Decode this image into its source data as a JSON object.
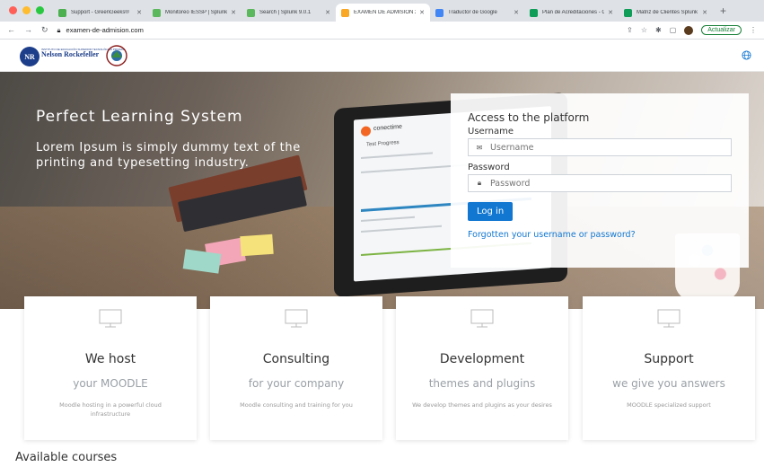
{
  "browser": {
    "tabs": [
      {
        "title": "Support - GreenGeeks®",
        "color": "#4caf50"
      },
      {
        "title": "Monitoreo IESSP | Splunk",
        "color": "#5cb85c"
      },
      {
        "title": "Search | Splunk 9.0.1",
        "color": "#5cb85c"
      },
      {
        "title": "EXAMEN DE ADMISION 20",
        "color": "#f9a825",
        "active": true
      },
      {
        "title": "Traductor de Google",
        "color": "#4285f4"
      },
      {
        "title": "Plan de Acreditaciones - G",
        "color": "#0f9d58"
      },
      {
        "title": "Matriz de Clientes Splunk",
        "color": "#0f9d58"
      }
    ],
    "new_tab": "+",
    "url": "examen-de-admision.com",
    "update_label": "Actualizar"
  },
  "site": {
    "logo_initials": "NR",
    "logo_small": "INSTITUTO DE EDUCACIÓN SUPERIOR TECNOLÓGICO PRIVADO",
    "logo_name": "Nelson Rockefeller"
  },
  "hero": {
    "title": "Perfect Learning System",
    "subtitle": "Lorem Ipsum is simply dummy text of the printing and typesetting industry.",
    "laptop_app": "conectime",
    "laptop_heading": "Test Progress"
  },
  "login": {
    "heading": "Access to the platform",
    "username_label": "Username",
    "username_placeholder": "Username",
    "password_label": "Password",
    "password_placeholder": "Password",
    "submit": "Log in",
    "forgot": "Forgotten your username or password?"
  },
  "cards": [
    {
      "title": "We host",
      "subtitle": "your MOODLE",
      "desc": "Moodle hosting in a powerful cloud infrastructure"
    },
    {
      "title": "Consulting",
      "subtitle": "for your company",
      "desc": "Moodle consulting and training for you"
    },
    {
      "title": "Development",
      "subtitle": "themes and plugins",
      "desc": "We develop themes and plugins as your desires"
    },
    {
      "title": "Support",
      "subtitle": "we give you answers",
      "desc": "MOODLE specialized support"
    }
  ],
  "available_courses": "Available courses",
  "colors": {
    "accent": "#1177d1",
    "brand": "#1d3e8a"
  }
}
